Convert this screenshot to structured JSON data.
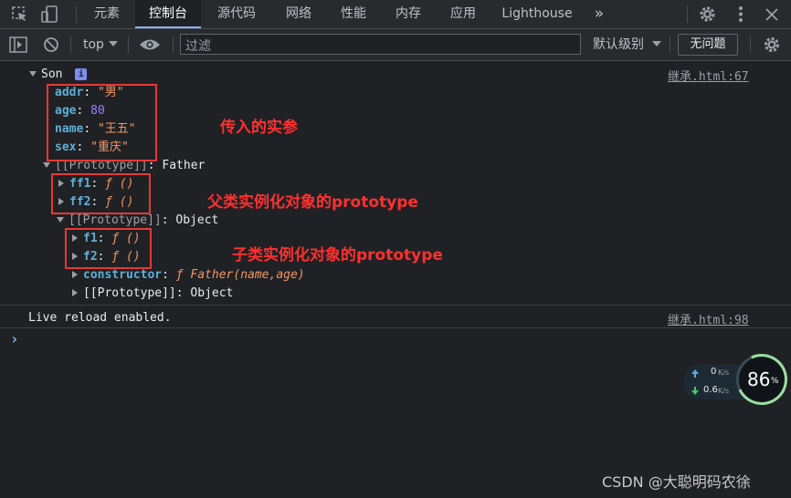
{
  "tabs": {
    "elements": "元素",
    "console": "控制台",
    "sources": "源代码",
    "network": "网络",
    "performance": "性能",
    "memory": "内存",
    "application": "应用",
    "lighthouse": "Lighthouse",
    "more": "»"
  },
  "toolbar": {
    "context": "top",
    "filter_placeholder": "过滤",
    "levels": "默认级别",
    "issues": "无问题"
  },
  "console": {
    "son_label": "Son",
    "info_badge": "i",
    "source1": "继承.html:67",
    "props": [
      {
        "key": "addr",
        "value": "\"男\""
      },
      {
        "key": "age",
        "value": "80"
      },
      {
        "key": "name",
        "value": "\"王五\""
      },
      {
        "key": "sex",
        "value": "\"重庆\""
      }
    ],
    "proto1_key": "[[Prototype]]",
    "proto1_value": ": Father",
    "ff1_key": "ff1",
    "ff2_key": "ff2",
    "fn_value": "ƒ ()",
    "proto2_key": "[[Prototype]]",
    "proto2_value": ": Object",
    "f1_key": "f1",
    "f2_key": "f2",
    "constructor_key": "constructor",
    "constructor_value": "ƒ Father(name,age)",
    "proto3_key": "[[Prototype]]",
    "proto3_value": ": Object",
    "live_reload": "Live reload enabled.",
    "source2": "继承.html:98",
    "prompt": "›"
  },
  "annotations": {
    "a1": "传入的实参",
    "a2": "父类实例化对象的prototype",
    "a3": "子类实例化对象的prototype"
  },
  "speed": {
    "up": "0",
    "up_unit": "K/s",
    "down": "0.6",
    "down_unit": "K/s",
    "percent": "86",
    "percent_unit": "%"
  },
  "watermark": "CSDN @大聪明码农徐"
}
